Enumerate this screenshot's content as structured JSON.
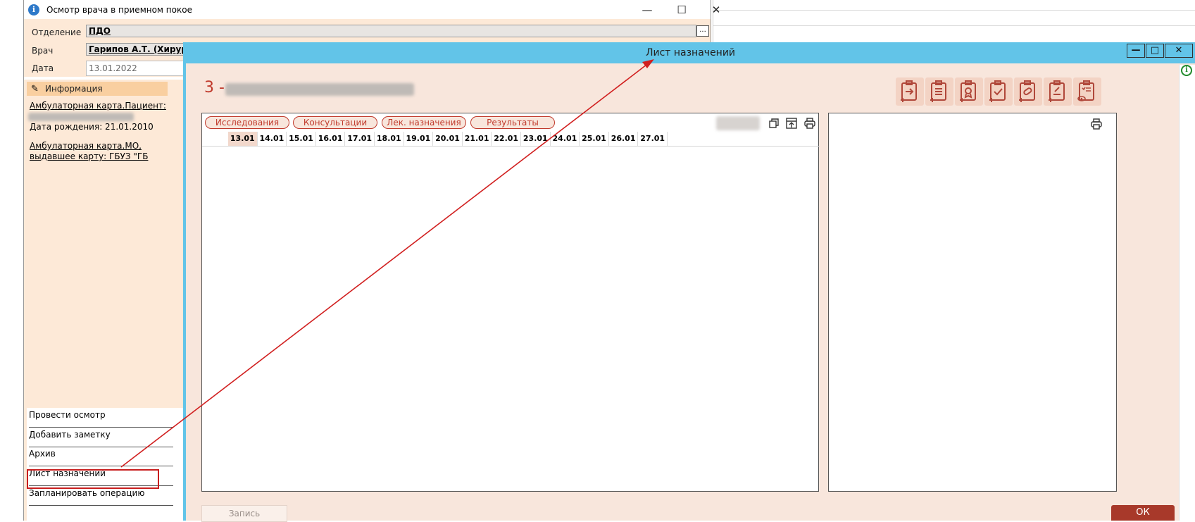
{
  "exam_window": {
    "title": "Осмотр врача в приемном покое",
    "minimize_glyph": "—",
    "maximize_glyph": "☐",
    "close_glyph": "✕",
    "fields": {
      "department_label": "Отделение",
      "department_value": "ПДО",
      "doctor_label": "Врач",
      "doctor_value": "Гарипов А.Т. (Хирург)",
      "date_label": "Дата",
      "date_value": "13.01.2022",
      "browse_label": "..."
    },
    "info_panel": {
      "header": "Информация",
      "patient_link": "Амбулаторная карта.Пациент:",
      "birth_date": "Дата рождения: 21.01.2010",
      "card_link_1": "Амбулаторная карта.МО,",
      "card_link_2": "выдавшее карту: ГБУЗ \"ГБ"
    },
    "actions": [
      {
        "label": "Провести осмотр"
      },
      {
        "label": "Добавить заметку"
      },
      {
        "label": "Архив"
      },
      {
        "label": "Лист назначений"
      },
      {
        "label": "Запланировать операцию"
      }
    ]
  },
  "rx_window": {
    "title": "Лист назначений",
    "minimize_glyph": "—",
    "maximize_glyph": "□",
    "close_glyph": "✕",
    "info_glyph": "i",
    "patient_number": "3 -",
    "tabs": [
      {
        "label": "Исследования"
      },
      {
        "label": "Консультации"
      },
      {
        "label": "Лек. назначения"
      },
      {
        "label": "Результаты"
      }
    ],
    "dates": [
      "13.01",
      "14.01",
      "15.01",
      "16.01",
      "17.01",
      "18.01",
      "19.01",
      "20.01",
      "21.01",
      "22.01",
      "23.01",
      "24.01",
      "25.01",
      "26.01",
      "27.01"
    ],
    "save_label": "Запись",
    "ok_label": "ОК"
  },
  "colors": {
    "title_bar": "#62c4e8",
    "accent_red": "#c0392b",
    "ok_button": "#a8392a",
    "panel_bg": "#f8e6dc",
    "left_panel_bg": "#fde9d7",
    "annotation": "#d11f1f"
  },
  "icons": {
    "toolbar": [
      "clipboard-arrow-icon",
      "clipboard-add-list-icon",
      "clipboard-award-icon",
      "clipboard-check-icon",
      "clipboard-pill-icon",
      "clipboard-pen-icon",
      "clipboard-view-icon"
    ],
    "pane": [
      "copy-icon",
      "export-icon",
      "print-icon"
    ]
  }
}
